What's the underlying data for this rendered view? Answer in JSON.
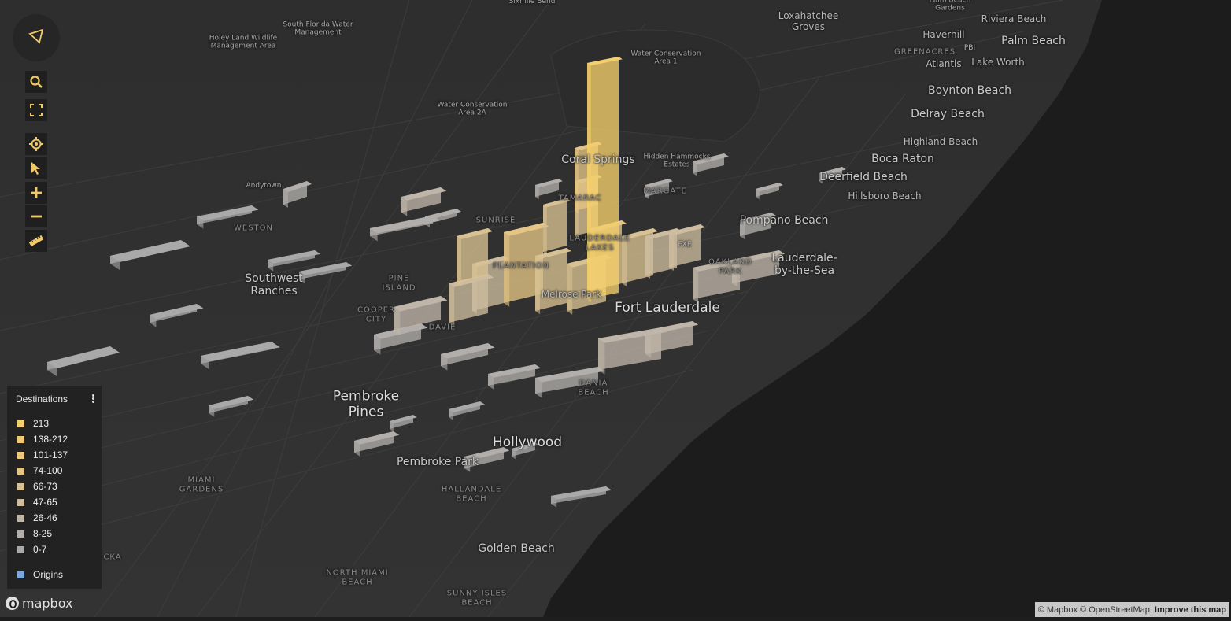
{
  "map": {
    "labels_small": [
      {
        "text": "Sixmile Bend",
        "cls": "small"
      },
      {
        "text": "Loxahatchee\nGroves",
        "cls": "town"
      },
      {
        "text": "Palm Beach\nGardens",
        "cls": "small"
      },
      {
        "text": "Riviera Beach",
        "cls": "town"
      },
      {
        "text": "Haverhill",
        "cls": "town"
      },
      {
        "text": "Palm Beach",
        "cls": "city"
      },
      {
        "text": "GREENACRES",
        "cls": "area"
      },
      {
        "text": "Atlantis",
        "cls": "town"
      },
      {
        "text": "Lake Worth",
        "cls": "town"
      },
      {
        "text": "Boynton Beach",
        "cls": "city"
      },
      {
        "text": "Delray Beach",
        "cls": "city"
      },
      {
        "text": "Highland Beach",
        "cls": "town"
      },
      {
        "text": "Boca Raton",
        "cls": "city"
      },
      {
        "text": "Deerfield Beach",
        "cls": "city"
      },
      {
        "text": "Hillsboro Beach",
        "cls": "town"
      },
      {
        "text": "Pompano Beach",
        "cls": "city"
      },
      {
        "text": "Lauderdale-\nby-the-Sea",
        "cls": "city"
      },
      {
        "text": "Fort Lauderdale",
        "cls": "big"
      },
      {
        "text": "Coral Springs",
        "cls": "city"
      },
      {
        "text": "Hidden Hammocks\nEstates",
        "cls": "small"
      },
      {
        "text": "MARGATE",
        "cls": "area"
      },
      {
        "text": "TAMARAC",
        "cls": "area"
      },
      {
        "text": "SUNRISE",
        "cls": "area"
      },
      {
        "text": "LAUDERDALE\nLAKES",
        "cls": "area"
      },
      {
        "text": "PLANTATION",
        "cls": "area"
      },
      {
        "text": "OAKLAND\nPARK",
        "cls": "area"
      },
      {
        "text": "FXE",
        "cls": "air"
      },
      {
        "text": "PBI",
        "cls": "air"
      },
      {
        "text": "Melrose Park",
        "cls": "town"
      },
      {
        "text": "PINE\nISLAND",
        "cls": "area"
      },
      {
        "text": "COOPER\nCITY",
        "cls": "area"
      },
      {
        "text": "DAVIE",
        "cls": "area"
      },
      {
        "text": "WESTON",
        "cls": "area"
      },
      {
        "text": "Andytown",
        "cls": "small"
      },
      {
        "text": "Southwest\nRanches",
        "cls": "city"
      },
      {
        "text": "Holey Land Wildlife\nManagement Area",
        "cls": "small"
      },
      {
        "text": "South Florida Water\nManagement",
        "cls": "small"
      },
      {
        "text": "Water Conservation\nArea 1",
        "cls": "small"
      },
      {
        "text": "Water Conservation\nArea 2A",
        "cls": "small"
      },
      {
        "text": "DANIA\nBEACH",
        "cls": "area"
      },
      {
        "text": "Pembroke\nPines",
        "cls": "big"
      },
      {
        "text": "Hollywood",
        "cls": "big"
      },
      {
        "text": "Pembroke Park",
        "cls": "city"
      },
      {
        "text": "HALLANDALE\nBEACH",
        "cls": "area"
      },
      {
        "text": "MIAMI\nGARDENS",
        "cls": "area"
      },
      {
        "text": "Golden Beach",
        "cls": "city"
      },
      {
        "text": "NORTH MIAMI\nBEACH",
        "cls": "area"
      },
      {
        "text": "SUNNY ISLES\nBEACH",
        "cls": "area"
      },
      {
        "text": "CKA",
        "cls": "area"
      }
    ]
  },
  "controls": {
    "compass": "compass-icon",
    "search": "search-icon",
    "fullscreen": "fullscreen-icon",
    "locate": "locate-icon",
    "select": "pointer-icon",
    "zoom_in": "plus-icon",
    "zoom_out": "minus-icon",
    "measure": "ruler-icon"
  },
  "legend": {
    "title": "Destinations",
    "menu_icon": "more-vertical-icon",
    "items": [
      {
        "label": "213",
        "color": "#f5cf6c"
      },
      {
        "label": "138-212",
        "color": "#f0cb72"
      },
      {
        "label": "101-137",
        "color": "#ebc87a"
      },
      {
        "label": "74-100",
        "color": "#e4c585"
      },
      {
        "label": "66-73",
        "color": "#d8c192"
      },
      {
        "label": "47-65",
        "color": "#cdbc9f"
      },
      {
        "label": "26-46",
        "color": "#bfb5a8"
      },
      {
        "label": "8-25",
        "color": "#b1aeab"
      },
      {
        "label": "0-7",
        "color": "#a9a9a9"
      }
    ],
    "origins": {
      "label": "Origins",
      "color": "#7ca7dd"
    }
  },
  "logo": {
    "text": "mapbox"
  },
  "attribution": {
    "mapbox": "© Mapbox",
    "osm": "© OpenStreetMap",
    "improve": "Improve this map"
  }
}
